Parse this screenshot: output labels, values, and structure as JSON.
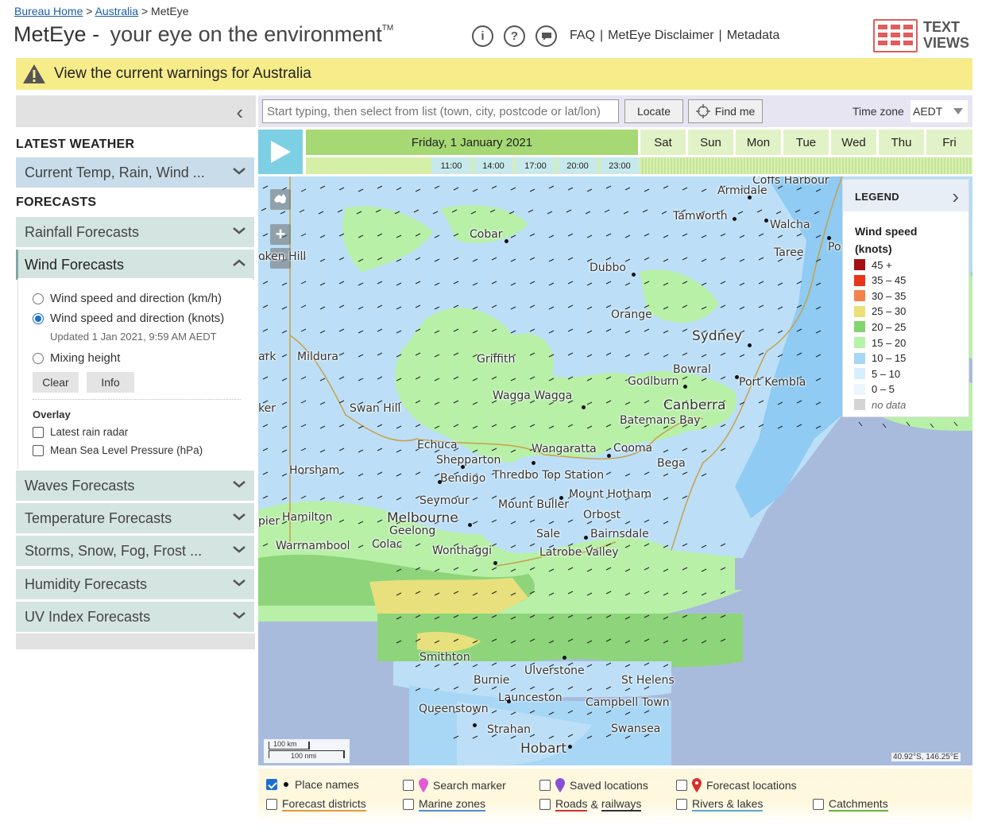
{
  "breadcrumb": {
    "home": "Bureau Home",
    "sep1": ">",
    "region": "Australia",
    "sep2": ">",
    "current": "MetEye"
  },
  "header": {
    "title": "MetEye",
    "dash": "-",
    "subtitle": "your eye on the environment",
    "tm": "TM",
    "links": [
      "FAQ",
      "MetEye Disclaimer",
      "Metadata"
    ],
    "link_sep": "|",
    "text_views": "TEXT VIEWS",
    "icon_info": "i",
    "icon_help": "?"
  },
  "warning": {
    "text": "View the current warnings for Australia",
    "icon": "warning-triangle-icon"
  },
  "sidebar": {
    "latest_heading": "LATEST WEATHER",
    "latest_item": "Current Temp, Rain, Wind ...",
    "forecasts_heading": "FORECASTS",
    "rainfall": "Rainfall Forecasts",
    "wind": "Wind Forecasts",
    "wind_options": {
      "kmh": "Wind speed and direction (km/h)",
      "knots": "Wind speed and direction (knots)",
      "updated": "Updated 1 Jan 2021, 9:59 AM AEDT",
      "mixing": "Mixing height",
      "clear": "Clear",
      "info": "Info",
      "overlay_title": "Overlay",
      "radar": "Latest rain radar",
      "mslp": "Mean Sea Level Pressure (hPa)"
    },
    "waves": "Waves Forecasts",
    "temperature": "Temperature Forecasts",
    "storms": "Storms, Snow, Fog, Frost ...",
    "humidity": "Humidity Forecasts",
    "uv": "UV Index Forecasts"
  },
  "search": {
    "placeholder": "Start typing, then select from list (town, city, postcode or lat/lon)",
    "locate": "Locate",
    "find_me": "Find me",
    "tz_label": "Time zone",
    "tz_value": "AEDT"
  },
  "timeline": {
    "selected_day": "Friday, 1 January 2021",
    "days": [
      "Sat",
      "Sun",
      "Mon",
      "Tue",
      "Wed",
      "Thu",
      "Fri"
    ],
    "hours": [
      "11:00",
      "14:00",
      "17:00",
      "20:00",
      "23:00"
    ]
  },
  "map": {
    "places": [
      "Coffs Harbour",
      "Armidale",
      "Tamworth",
      "Walcha",
      "Cobar",
      "Taree",
      "Po",
      "oken Hill",
      "Dubbo",
      "Orange",
      "Sydney",
      "Griffith",
      "Bowral",
      "Goulburn",
      "Port Kembla",
      "Mildura",
      "ark",
      "Wagga Wagga",
      "Canberra",
      "Batemans Bay",
      "Swan Hill",
      "ker",
      "Echuca",
      "Shepparton",
      "Wangaratta",
      "Cooma",
      "Bega",
      "Horsham",
      "Bendigo",
      "Thredbo Top Station",
      "Mount Hotham",
      "Seymour",
      "Mount Buller",
      "Orbost",
      "Hamilton",
      "pier",
      "Melbourne",
      "Geelong",
      "Sale",
      "Bairnsdale",
      "Warrnambool",
      "Colac",
      "Wonthaggi",
      "Latrobe Valley",
      "Smithton",
      "Ulverstone",
      "St Helens",
      "Burnie",
      "Launceston",
      "Campbell Town",
      "Queenstown",
      "Strahan",
      "Swansea",
      "Hobart"
    ],
    "scale_km": "100 km",
    "scale_nmi": "100 nmi",
    "coords": "40.92°S, 146.25°E"
  },
  "legend": {
    "title": "LEGEND",
    "subtitle_line1": "Wind speed",
    "subtitle_line2": "(knots)",
    "rows": [
      {
        "label": "45 +",
        "color": "#a50f15"
      },
      {
        "label": "35 – 45",
        "color": "#e8351c"
      },
      {
        "label": "30 – 35",
        "color": "#f5824b"
      },
      {
        "label": "25 – 30",
        "color": "#ece07a"
      },
      {
        "label": "20 – 25",
        "color": "#82d46e"
      },
      {
        "label": "15 – 20",
        "color": "#b6f3a6"
      },
      {
        "label": "10 – 15",
        "color": "#a8d6f5"
      },
      {
        "label": "5 – 10",
        "color": "#d5efff"
      },
      {
        "label": "0 – 5",
        "color": "#eef6fd"
      },
      {
        "label": "no data",
        "color": "#d4d4d4"
      }
    ]
  },
  "layers": {
    "place_names": "Place names",
    "search_marker": "Search marker",
    "saved_locations": "Saved locations",
    "forecast_locations": "Forecast locations",
    "forecast_districts": "Forecast districts",
    "marine_zones": "Marine zones",
    "roads": "Roads",
    "amp": "&",
    "railways": "railways",
    "rivers": "Rivers & lakes",
    "catchments": "Catchments"
  }
}
